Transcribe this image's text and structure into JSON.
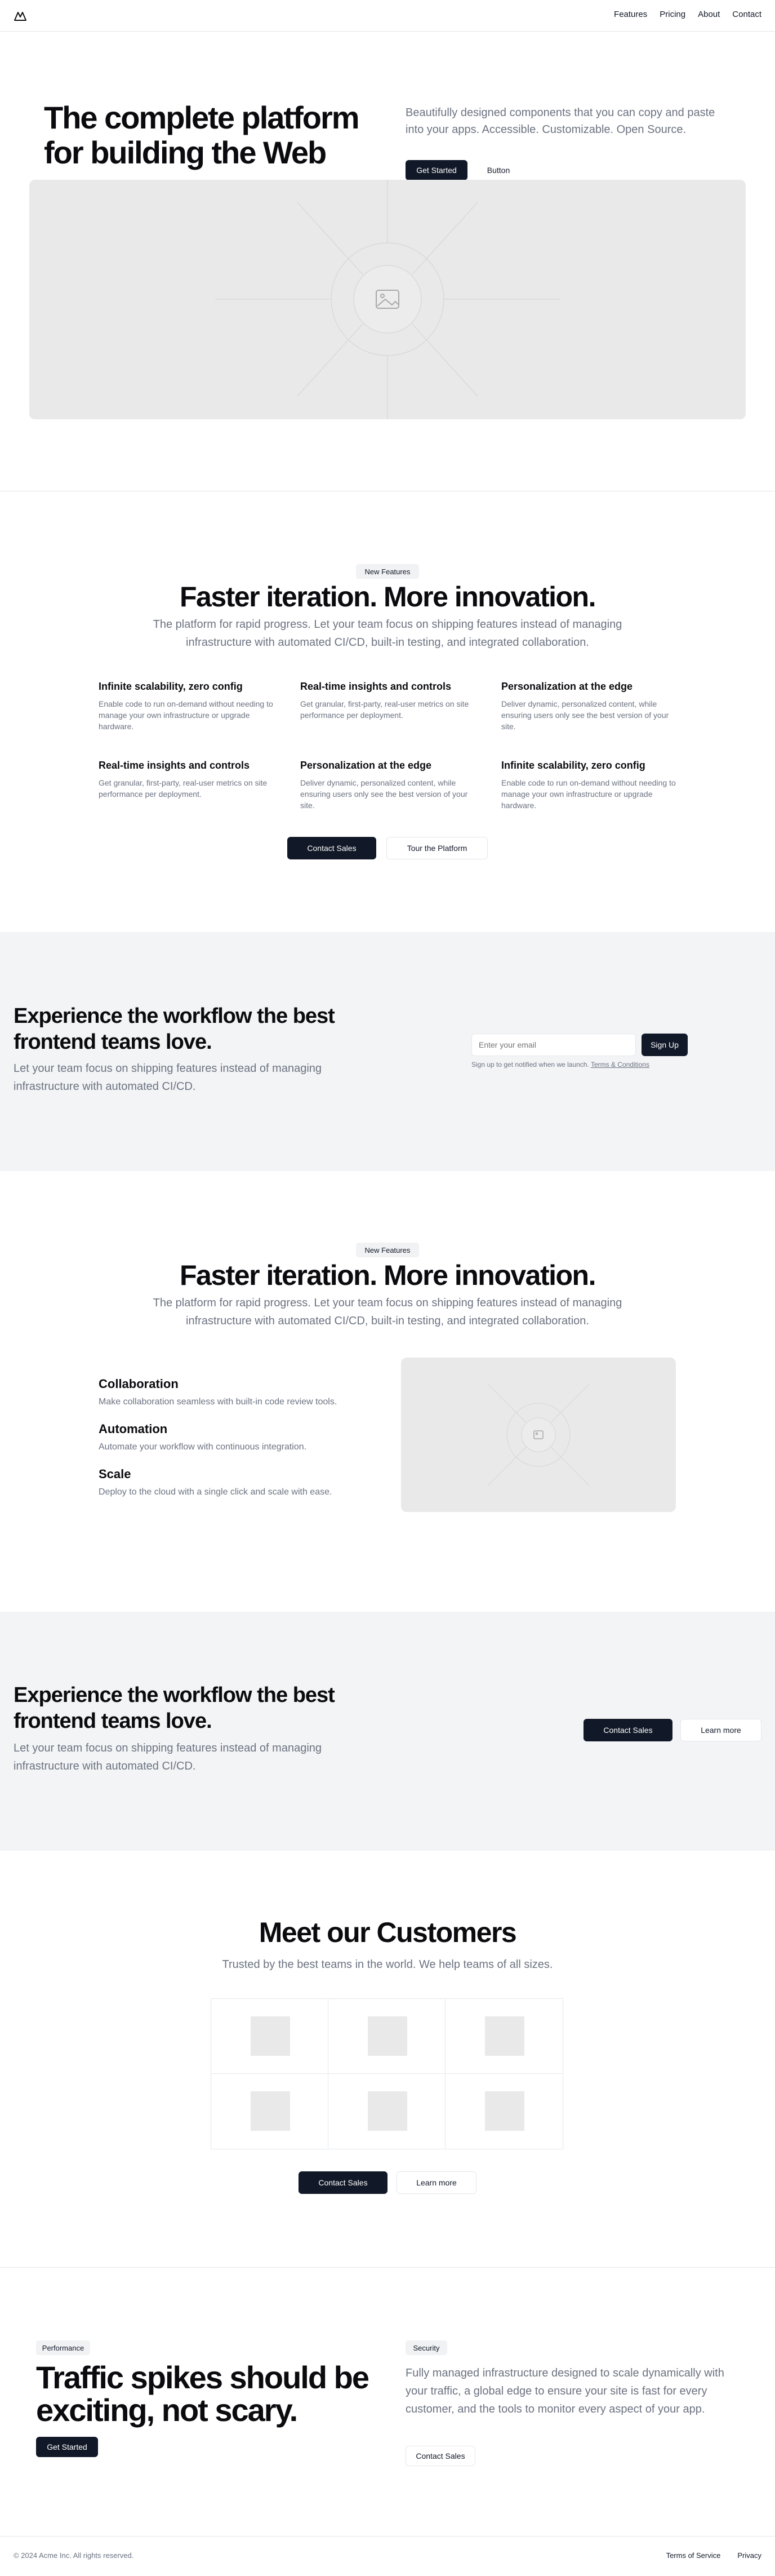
{
  "nav": {
    "items": [
      "Features",
      "Pricing",
      "About",
      "Contact"
    ]
  },
  "hero": {
    "title": "The complete platform for building the Web",
    "subtitle": "Beautifully designed components that you can copy and paste into your apps. Accessible. Customizable. Open Source.",
    "primary": "Get Started",
    "secondary": "Button"
  },
  "features": {
    "badge": "New Features",
    "title": "Faster iteration. More innovation.",
    "subtitle": "The platform for rapid progress. Let your team focus on shipping features instead of managing infrastructure with automated CI/CD, built-in testing, and integrated collaboration.",
    "items": [
      {
        "title": "Infinite scalability, zero config",
        "text": "Enable code to run on-demand without needing to manage your own infrastructure or upgrade hardware."
      },
      {
        "title": "Real-time insights and controls",
        "text": "Get granular, first-party, real-user metrics on site performance per deployment."
      },
      {
        "title": "Personalization at the edge",
        "text": "Deliver dynamic, personalized content, while ensuring users only see the best version of your site."
      },
      {
        "title": "Real-time insights and controls",
        "text": "Get granular, first-party, real-user metrics on site performance per deployment."
      },
      {
        "title": "Personalization at the edge",
        "text": "Deliver dynamic, personalized content, while ensuring users only see the best version of your site."
      },
      {
        "title": "Infinite scalability, zero config",
        "text": "Enable code to run on-demand without needing to manage your own infrastructure or upgrade hardware."
      }
    ],
    "primary": "Contact Sales",
    "secondary": "Tour the Platform"
  },
  "cta1": {
    "title": "Experience the workflow the best frontend teams love.",
    "subtitle": "Let your team focus on shipping features instead of managing infrastructure with automated CI/CD.",
    "email_placeholder": "Enter your email",
    "button": "Sign Up",
    "legal": "Sign up to get notified when we launch.",
    "legal_link": "Terms & Conditions"
  },
  "features2": {
    "badge": "New Features",
    "title": "Faster iteration. More innovation.",
    "subtitle": "The platform for rapid progress. Let your team focus on shipping features instead of managing infrastructure with automated CI/CD, built-in testing, and integrated collaboration.",
    "items": [
      {
        "title": "Collaboration",
        "text": "Make collaboration seamless with built-in code review tools."
      },
      {
        "title": "Automation",
        "text": "Automate your workflow with continuous integration."
      },
      {
        "title": "Scale",
        "text": "Deploy to the cloud with a single click and scale with ease."
      }
    ]
  },
  "cta2": {
    "title": "Experience the workflow the best frontend teams love.",
    "subtitle": "Let your team focus on shipping features instead of managing infrastructure with automated CI/CD.",
    "primary": "Contact Sales",
    "secondary": "Learn more"
  },
  "customers": {
    "title": "Meet our Customers",
    "subtitle": "Trusted by the best teams in the world. We help teams of all sizes.",
    "primary": "Contact Sales",
    "secondary": "Learn more"
  },
  "performance": {
    "badge": "Performance",
    "title": "Traffic spikes should be exciting, not scary.",
    "primary": "Get Started",
    "badge2": "Security",
    "text": "Fully managed infrastructure designed to scale dynamically with your traffic, a global edge to ensure your site is fast for every customer, and the tools to monitor every aspect of your app.",
    "secondary": "Contact Sales"
  },
  "footer": {
    "copyright": "© 2024 Acme Inc. All rights reserved.",
    "links": [
      "Terms of Service",
      "Privacy"
    ]
  },
  "colors": {
    "primary": "#111827",
    "muted": "#6b7280",
    "band": "#f3f4f6",
    "placeholder": "#e9e9e9"
  }
}
